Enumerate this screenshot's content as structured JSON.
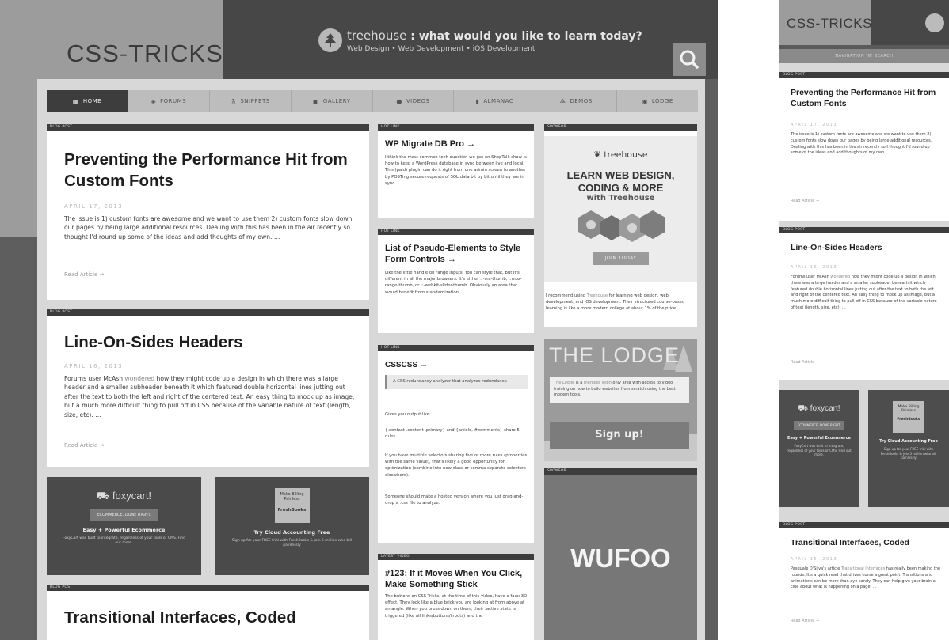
{
  "header": {
    "logo_part1": "CSS",
    "logo_dash": "-",
    "logo_part2": "TRICKS",
    "treehouse_brand": "treehouse",
    "treehouse_sep": " : ",
    "treehouse_tagline": "what would you like to learn today?",
    "treehouse_topics": "Web Design • Web Development • iOS Development",
    "search_icon": "search-icon"
  },
  "nav": [
    {
      "label": "HOME",
      "icon": "grid-icon",
      "glyph": "▦"
    },
    {
      "label": "FORUMS",
      "icon": "forum-icon",
      "glyph": "◈"
    },
    {
      "label": "SNIPPETS",
      "icon": "snippet-icon",
      "glyph": "⚗"
    },
    {
      "label": "GALLERY",
      "icon": "gallery-icon",
      "glyph": "▣"
    },
    {
      "label": "VIDEOS",
      "icon": "video-icon",
      "glyph": "●"
    },
    {
      "label": "ALMANAC",
      "icon": "book-icon",
      "glyph": "▮"
    },
    {
      "label": "DEMOS",
      "icon": "demo-icon",
      "glyph": "⟁"
    },
    {
      "label": "LODGE",
      "icon": "lodge-icon",
      "glyph": "◉"
    }
  ],
  "labels": {
    "blog_post": "BLOG POST",
    "hot_link": "HOT LINK",
    "sponsor": "SPONSOR",
    "latest_video": "LATEST VIDEO"
  },
  "posts": [
    {
      "title": "Preventing the Performance Hit from Custom Fonts",
      "date": "APRIL 17, 2013",
      "excerpt": "The issue is 1) custom fonts are awesome and we want to use them 2) custom fonts slow down our pages by being large additional resources. Dealing with this has been in the air recently so I thought I'd round up some of the ideas and add thoughts of my own. …",
      "read_more": "Read Article →"
    },
    {
      "title": "Line-On-Sides Headers",
      "date": "APRIL 16, 2013",
      "excerpt_pre": "Forums user McAsh ",
      "excerpt_link": "wondered",
      "excerpt_post": " how they might code up a design in which there was a large header and a smaller subheader beneath it which featured double horizontal lines jutting out after the text to both the left and right of the centered text. An easy thing to mock up as image, but a much more difficult thing to pull off in CSS because of the variable nature of text (length, size, etc). …",
      "read_more": "Read Article →"
    },
    {
      "title": "Transitional Interfaces, Coded",
      "date": "APRIL 15, 2013",
      "excerpt_pre": "Pasquale D'Silva's article ",
      "excerpt_link": "Transitional Interfaces",
      "excerpt_post": " has really been making the rounds. It's a quick read that drives home a great point. Transitions and animations can be more than eye candy. They can help give your brain a clue about what is happening on a page. …",
      "read_more": "Read Article →"
    }
  ],
  "ads": {
    "foxy_logo": "foxycart!",
    "foxy_box": "ECOMMERCE. DONE RIGHT.",
    "foxy_title": "Easy + Powerful Ecommerce",
    "foxy_desc": "FoxyCart was built to integrate, regardless of your tools or CMS. Find out more.",
    "fresh_badge": "Make Billing Painless",
    "fresh_logo": "FreshBooks",
    "fresh_title": "Try Cloud Accounting Free",
    "fresh_desc": "Sign up for your FREE trial with FreshBooks & join 5 million who bill painlessly"
  },
  "hot_links": [
    {
      "title": "WP Migrate DB Pro →",
      "text": "I think the most common tech question we get on ShopTalk show is how to keep a WordPress database in sync between live and local. This (paid) plugin can do it right from one admin screen to another by POSTing secure requests of SQL data bit by bit until they are in sync."
    },
    {
      "title": "List of Pseudo-Elements to Style Form Controls →",
      "text": "Like the little handle on range inputs. You can style that, but it's different in all the major browsers. It's either ::-ms-thumb, ::moz-range-thumb, or ::-webkit-slider-thumb. Obviously an area that would benefit from standardization."
    },
    {
      "title": "CSSCSS →",
      "quote": "A CSS redundancy analyzer that analyzes redundancy.",
      "p1": "Gives you output like:",
      "p2": "{.contact .content .primary} and {article, #comments} share 5 rules",
      "p3": "If you have multiple selectors sharing five or more rules (properties with the same value), that's likely a good opportunity for optimization (combine into new class or comma separate selectors elsewhere).",
      "p4": "Someone should make a hosted version where you just drag-and-drop a .css file to analyze."
    },
    {
      "title": "#123: If it Moves When You Click, Make Something Stick",
      "text": "The buttons on CSS-Tricks, at the time of this video, have a faux 3D effect. They look like a blue brick you are looking at from above at an angle. When you press down on them, their :active state is triggered (like all links/buttons/inputs) and the"
    }
  ],
  "sponsor_treehouse": {
    "logo": "treehouse",
    "headline1": "LEARN WEB DESIGN,",
    "headline2": "CODING & MORE",
    "with": "with Treehouse",
    "button": "JOIN TODAY",
    "caption_pre": "I recommend using ",
    "caption_link": "Treehouse",
    "caption_post": " for learning web design, web development, and iOS development. Their structured course-based learning is like a more modern college at about 1% of the price."
  },
  "lodge": {
    "title": "THE LODGE",
    "text_pre": "The Lodge",
    "text_mid": " is a ",
    "text_link": "member login",
    "text_post": " only area with access to video training on how to build websites from scratch using the best modern tools.",
    "button": "Sign up!"
  },
  "wufoo": {
    "logo": "WUFOO"
  },
  "mobile": {
    "logo": "CSS-TRICKS",
    "nav_label": "NAVIGATION 'N' SEARCH"
  },
  "colors": {
    "accent": "#3d3d3d",
    "highlight": "#8a8a8a",
    "background": "#5e5e5e"
  }
}
